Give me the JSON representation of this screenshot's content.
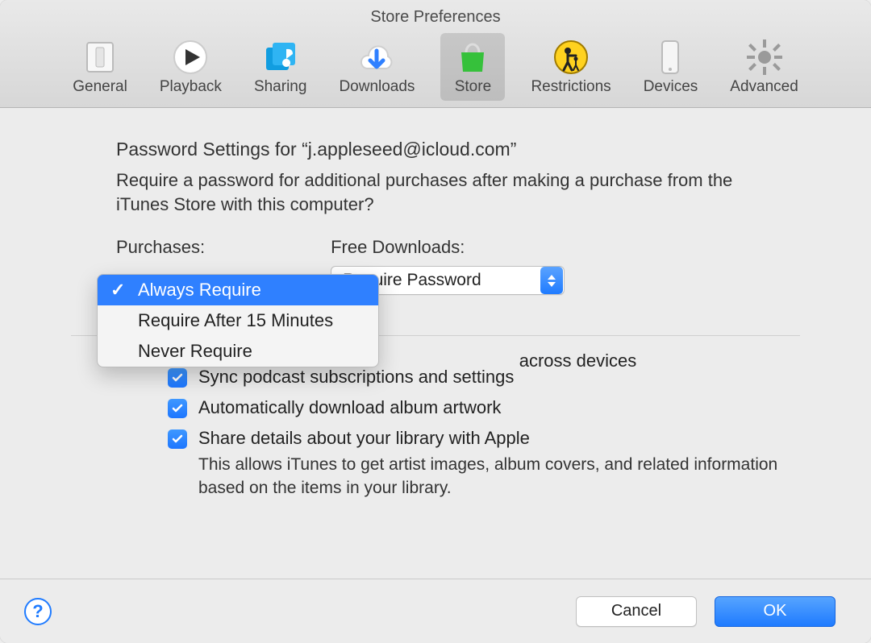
{
  "window": {
    "title": "Store Preferences"
  },
  "toolbar": {
    "items": [
      {
        "label": "General"
      },
      {
        "label": "Playback"
      },
      {
        "label": "Sharing"
      },
      {
        "label": "Downloads"
      },
      {
        "label": "Store"
      },
      {
        "label": "Restrictions"
      },
      {
        "label": "Devices"
      },
      {
        "label": "Advanced"
      }
    ],
    "selected_index": 4
  },
  "section": {
    "title": "Password Settings for “j.appleseed@icloud.com”",
    "description": "Require a password for additional purchases after making a purchase from the iTunes Store with this computer?"
  },
  "purchases": {
    "label": "Purchases:",
    "options": [
      "Always Require",
      "Require After 15 Minutes",
      "Never Require"
    ],
    "selected_index": 0
  },
  "free_downloads": {
    "label": "Free Downloads:",
    "selected": "Require Password"
  },
  "checks": {
    "obscured_tail": " across devices",
    "items": [
      {
        "label": "Sync podcast subscriptions and settings",
        "checked": true
      },
      {
        "label": "Automatically download album artwork",
        "checked": true
      },
      {
        "label": "Share details about your library with Apple",
        "checked": true,
        "sub": "This allows iTunes to get artist images, album covers, and related information based on the items in your library."
      }
    ]
  },
  "footer": {
    "help": "?",
    "cancel": "Cancel",
    "ok": "OK"
  }
}
